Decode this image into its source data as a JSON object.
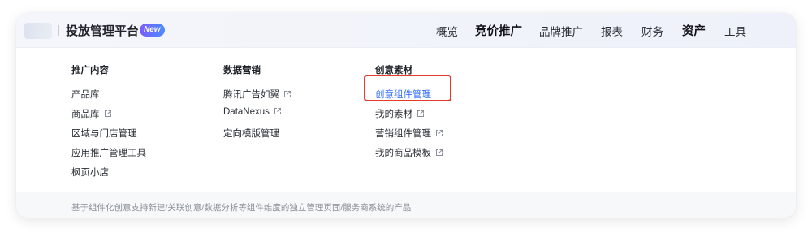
{
  "header": {
    "brand_title": "投放管理平台",
    "new_badge": "New",
    "nav": [
      {
        "label": "概览",
        "bold": false
      },
      {
        "label": "竞价推广",
        "bold": true
      },
      {
        "label": "品牌推广",
        "bold": false
      },
      {
        "label": "报表",
        "bold": false
      },
      {
        "label": "财务",
        "bold": false
      },
      {
        "label": "资产",
        "bold": true
      },
      {
        "label": "工具",
        "bold": false
      }
    ]
  },
  "menu": {
    "columns": [
      {
        "title": "推广内容",
        "items": [
          {
            "label": "产品库",
            "external": false
          },
          {
            "label": "商品库",
            "external": true
          },
          {
            "label": "区域与门店管理",
            "external": false
          },
          {
            "label": "应用推广管理工具",
            "external": false
          },
          {
            "label": "枫页小店",
            "external": false
          }
        ]
      },
      {
        "title": "数据营销",
        "items": [
          {
            "label": "腾讯广告如翼",
            "external": true
          },
          {
            "label": "DataNexus",
            "external": true
          },
          {
            "label": "定向模版管理",
            "external": false
          }
        ]
      },
      {
        "title": "创意素材",
        "items": [
          {
            "label": "创意组件管理",
            "external": false,
            "active": true
          },
          {
            "label": "我的素材",
            "external": true
          },
          {
            "label": "营销组件管理",
            "external": true
          },
          {
            "label": "我的商品模板",
            "external": true
          }
        ]
      }
    ]
  },
  "footer": {
    "description": "基于组件化创意支持新建/关联创意/数据分析等组件维度的独立管理页面/服务商系统的产品"
  },
  "colors": {
    "accent": "#3370ff",
    "highlight_border": "#e23a2b",
    "text": "#2b2f36"
  }
}
